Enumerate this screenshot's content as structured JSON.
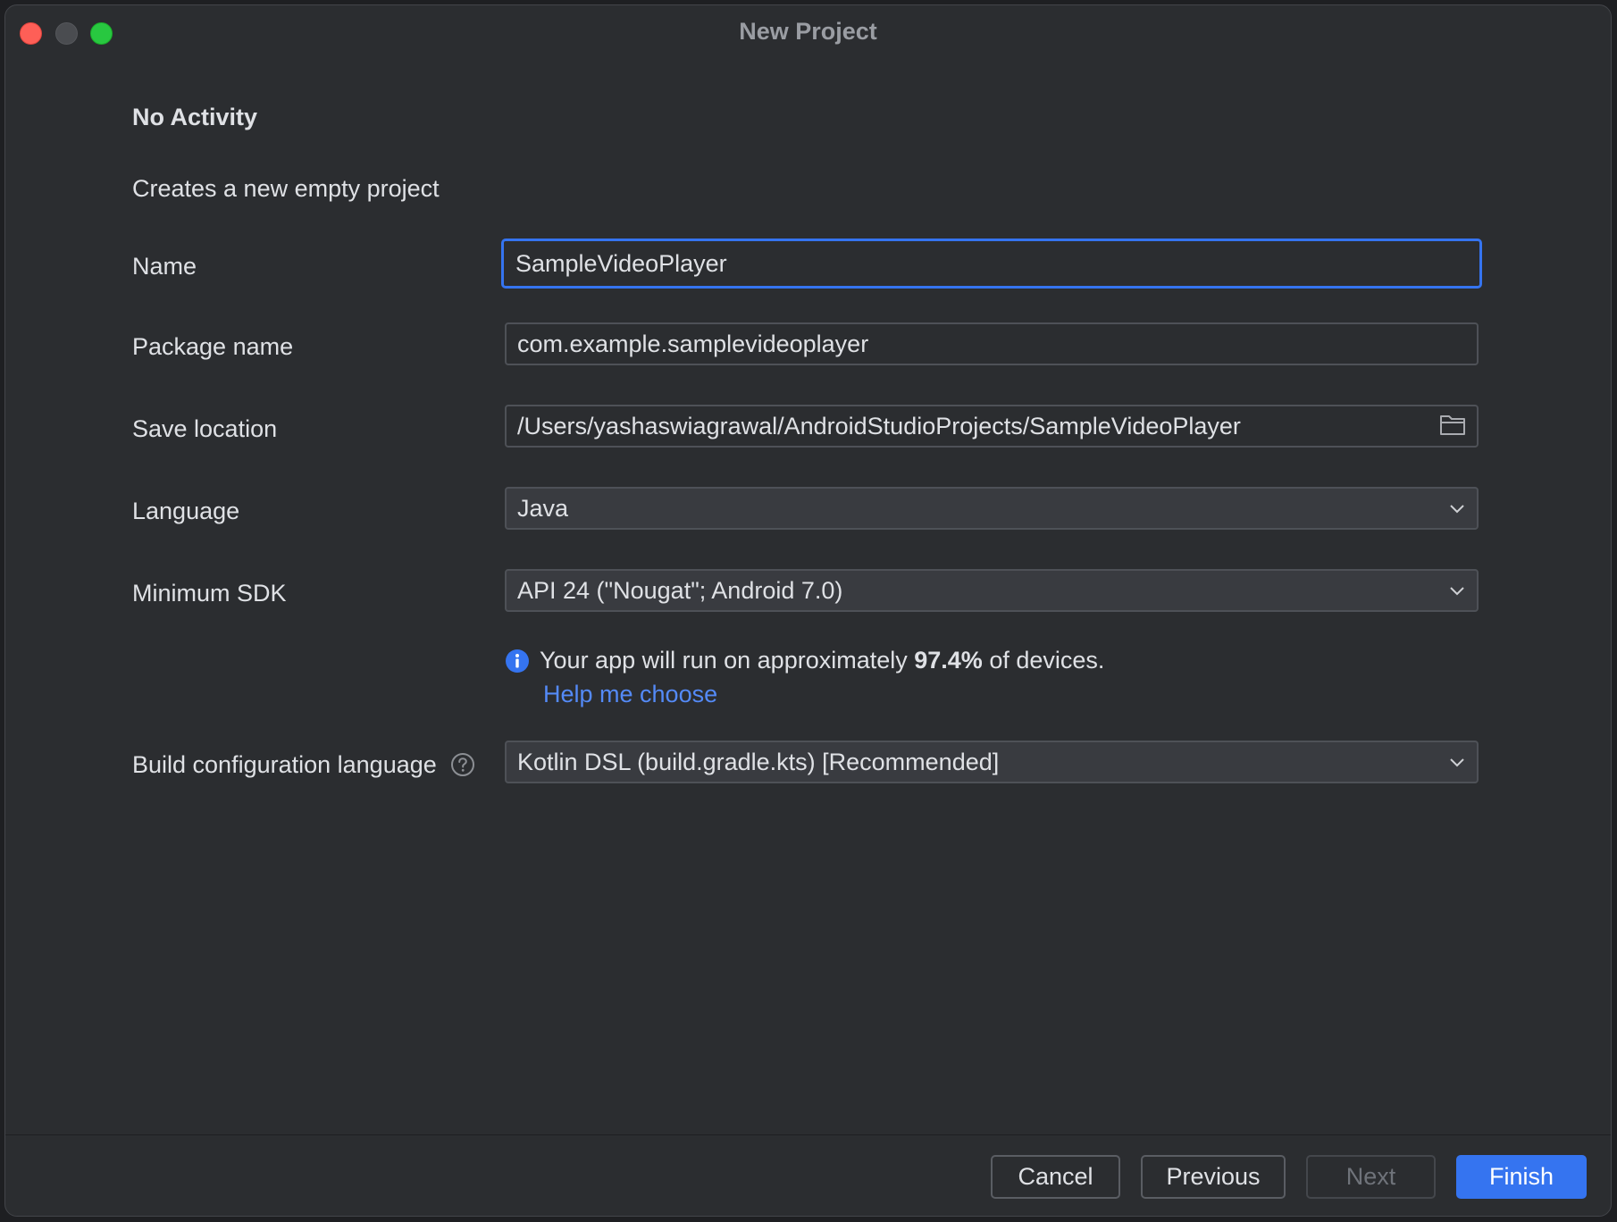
{
  "window": {
    "title": "New Project"
  },
  "template": {
    "heading": "No Activity",
    "description": "Creates a new empty project"
  },
  "form": {
    "name": {
      "label": "Name",
      "value": "SampleVideoPlayer"
    },
    "package_name": {
      "label": "Package name",
      "value": "com.example.samplevideoplayer"
    },
    "save_location": {
      "label": "Save location",
      "value": "/Users/yashaswiagrawal/AndroidStudioProjects/SampleVideoPlayer",
      "icon": "folder-icon"
    },
    "language": {
      "label": "Language",
      "selected": "Java",
      "icon": "chevron-down-icon"
    },
    "minimum_sdk": {
      "label": "Minimum SDK",
      "selected": "API 24 (\"Nougat\"; Android 7.0)",
      "icon": "chevron-down-icon"
    },
    "sdk_info": {
      "icon": "info-icon",
      "prefix": "Your app will run on approximately ",
      "percentage": "97.4%",
      "suffix": " of devices.",
      "link": "Help me choose"
    },
    "build_config": {
      "label": "Build configuration language",
      "help_icon": "question-mark-icon",
      "selected": "Kotlin DSL (build.gradle.kts) [Recommended]",
      "icon": "chevron-down-icon"
    }
  },
  "buttons": {
    "cancel": "Cancel",
    "previous": "Previous",
    "next": "Next",
    "finish": "Finish"
  },
  "colors": {
    "background": "#2b2d30",
    "accent": "#3574f0",
    "link": "#548af7",
    "text": "#dfe1e5",
    "close": "#fe5f57",
    "zoom": "#28c840"
  }
}
